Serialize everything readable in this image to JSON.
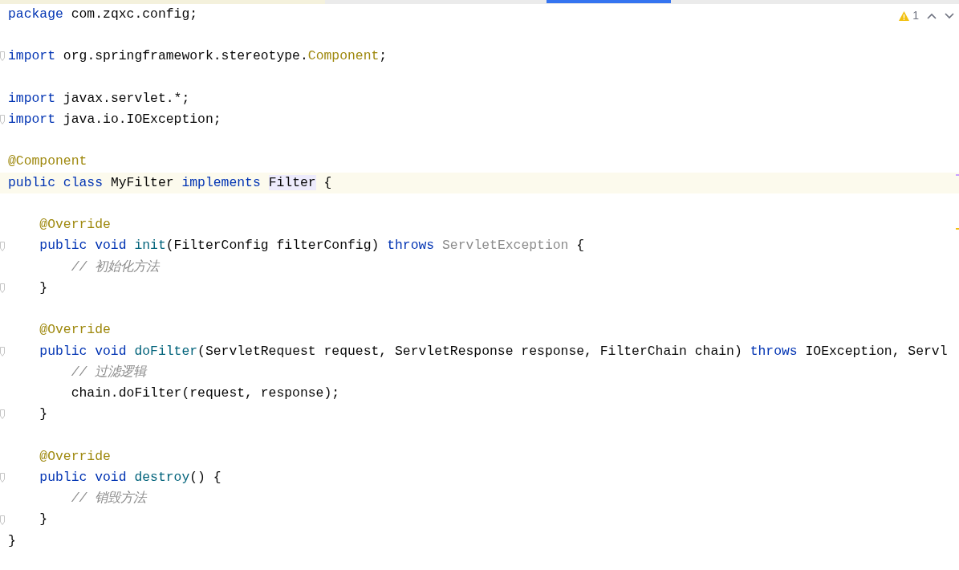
{
  "inspections": {
    "warnings": "1"
  },
  "lines": [
    {
      "current": false,
      "fold": false,
      "tokens": [
        {
          "kind": "keyword",
          "text": "package"
        },
        {
          "kind": "plain",
          "text": " com.zqxc.config;"
        }
      ]
    },
    {
      "current": false,
      "fold": false
    },
    {
      "current": false,
      "fold": true,
      "tokens": [
        {
          "kind": "keyword",
          "text": "import"
        },
        {
          "kind": "plain",
          "text": " org.springframework.stereotype."
        },
        {
          "kind": "annotation",
          "text": "Component"
        },
        {
          "kind": "plain",
          "text": ";"
        }
      ]
    },
    {
      "current": false,
      "fold": false
    },
    {
      "current": false,
      "fold": false,
      "tokens": [
        {
          "kind": "keyword",
          "text": "import"
        },
        {
          "kind": "plain",
          "text": " javax.servlet.*;"
        }
      ]
    },
    {
      "current": false,
      "fold": true,
      "tokens": [
        {
          "kind": "keyword",
          "text": "import"
        },
        {
          "kind": "plain",
          "text": " java.io.IOException;"
        }
      ]
    },
    {
      "current": false,
      "fold": false
    },
    {
      "current": false,
      "fold": false,
      "tokens": [
        {
          "kind": "annotation",
          "text": "@Component"
        }
      ]
    },
    {
      "current": true,
      "fold": false,
      "tokens": [
        {
          "kind": "keyword",
          "text": "public class"
        },
        {
          "kind": "plain",
          "text": " MyFilter "
        },
        {
          "kind": "keyword",
          "text": "implements "
        },
        {
          "kind": "highlight",
          "text": "Filter"
        },
        {
          "kind": "plain",
          "text": " {"
        }
      ]
    },
    {
      "current": false,
      "fold": false
    },
    {
      "current": false,
      "fold": false,
      "tokens": [
        {
          "kind": "annotation",
          "text": "    @Override"
        }
      ]
    },
    {
      "current": false,
      "fold": true,
      "tokens": [
        {
          "kind": "keyword",
          "text": "    public void "
        },
        {
          "kind": "method",
          "text": "init"
        },
        {
          "kind": "plain",
          "text": "(FilterConfig filterConfig) "
        },
        {
          "kind": "keyword",
          "text": "throws "
        },
        {
          "kind": "unused",
          "text": "ServletException"
        },
        {
          "kind": "plain",
          "text": " {"
        }
      ]
    },
    {
      "current": false,
      "fold": false,
      "tokens": [
        {
          "kind": "comment",
          "text": "        // 初始化方法"
        }
      ]
    },
    {
      "current": false,
      "fold": true,
      "tokens": [
        {
          "kind": "plain",
          "text": "    }"
        }
      ]
    },
    {
      "current": false,
      "fold": false
    },
    {
      "current": false,
      "fold": false,
      "tokens": [
        {
          "kind": "annotation",
          "text": "    @Override"
        }
      ]
    },
    {
      "current": false,
      "fold": true,
      "tokens": [
        {
          "kind": "keyword",
          "text": "    public void "
        },
        {
          "kind": "method",
          "text": "doFilter"
        },
        {
          "kind": "plain",
          "text": "(ServletRequest request, ServletResponse response, FilterChain chain) "
        },
        {
          "kind": "keyword",
          "text": "throws"
        },
        {
          "kind": "plain",
          "text": " IOException, Servl"
        }
      ]
    },
    {
      "current": false,
      "fold": false,
      "tokens": [
        {
          "kind": "comment",
          "text": "        // 过滤逻辑"
        }
      ]
    },
    {
      "current": false,
      "fold": false,
      "tokens": [
        {
          "kind": "plain",
          "text": "        chain.doFilter(request, response);"
        }
      ]
    },
    {
      "current": false,
      "fold": true,
      "tokens": [
        {
          "kind": "plain",
          "text": "    }"
        }
      ]
    },
    {
      "current": false,
      "fold": false
    },
    {
      "current": false,
      "fold": false,
      "tokens": [
        {
          "kind": "annotation",
          "text": "    @Override"
        }
      ]
    },
    {
      "current": false,
      "fold": true,
      "tokens": [
        {
          "kind": "keyword",
          "text": "    public void "
        },
        {
          "kind": "method",
          "text": "destroy"
        },
        {
          "kind": "plain",
          "text": "() {"
        }
      ]
    },
    {
      "current": false,
      "fold": false,
      "tokens": [
        {
          "kind": "comment",
          "text": "        // 销毁方法"
        }
      ]
    },
    {
      "current": false,
      "fold": true,
      "tokens": [
        {
          "kind": "plain",
          "text": "    }"
        }
      ]
    },
    {
      "current": false,
      "fold": false,
      "tokens": [
        {
          "kind": "plain",
          "text": "}"
        }
      ]
    }
  ]
}
